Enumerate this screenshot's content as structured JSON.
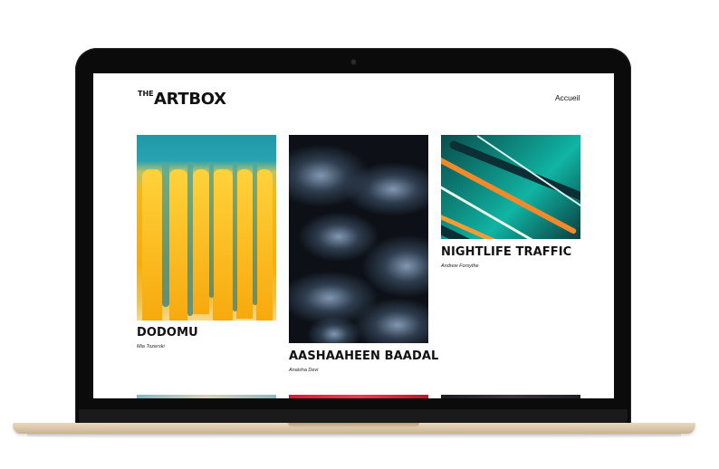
{
  "site": {
    "logo_the": "THE",
    "logo_name": "ARTBOX",
    "nav_home": "Accueil"
  },
  "artworks": [
    {
      "title": "DODOMU",
      "artist": "Mia Tozerski",
      "icon": "painting-yellow-drips"
    },
    {
      "title": "AASHAAHEEN BAADAL",
      "artist": "Anaisha Devi",
      "icon": "painting-dark-fluid"
    },
    {
      "title": "NIGHTLIFE TRAFFIC",
      "artist": "Andrew Forsythe",
      "icon": "painting-teal-marble"
    }
  ],
  "colors": {
    "laptop_body": "#0b0b0b",
    "laptop_base": "#d9c4a4",
    "text": "#111111",
    "screen_bg": "#ffffff"
  }
}
